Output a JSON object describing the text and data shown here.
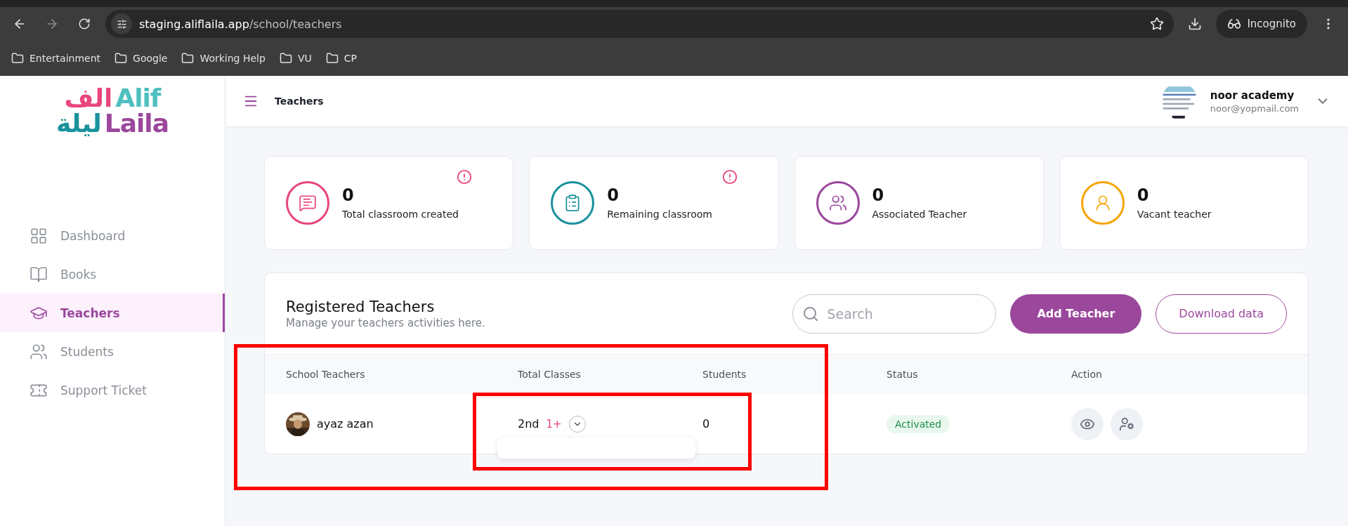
{
  "browser": {
    "url_host": "staging.aliflaila.app",
    "url_path": "/school/teachers",
    "profile": "Incognito",
    "bookmarks": [
      "Entertainment",
      "Google",
      "Working Help",
      "VU",
      "CP"
    ]
  },
  "logo": {
    "arabic_top": "الف",
    "latin_top": "Alif",
    "arabic_bottom": "ليلة",
    "latin_bottom": "Laila"
  },
  "sidebar": {
    "items": [
      {
        "label": "Dashboard",
        "selected": false
      },
      {
        "label": "Books",
        "selected": false
      },
      {
        "label": "Teachers",
        "selected": true
      },
      {
        "label": "Students",
        "selected": false
      },
      {
        "label": "Support Ticket",
        "selected": false
      }
    ]
  },
  "header": {
    "title": "Teachers",
    "user_name": "noor academy",
    "user_email": "noor@yopmail.com"
  },
  "stats": [
    {
      "value": "0",
      "label": "Total classroom created",
      "color": "#e8467c",
      "alert": true
    },
    {
      "value": "0",
      "label": "Remaining classroom",
      "color": "#1a929e",
      "alert": true
    },
    {
      "value": "0",
      "label": "Associated Teacher",
      "color": "#9b479c",
      "alert": false
    },
    {
      "value": "0",
      "label": "Vacant teacher",
      "color": "#f6a609",
      "alert": false
    }
  ],
  "table": {
    "title": "Registered Teachers",
    "subtitle": "Manage your teachers activities here.",
    "search_placeholder": "Search",
    "add_button": "Add Teacher",
    "download_button": "Download data",
    "columns": [
      "School Teachers",
      "Total Classes",
      "Students",
      "Status",
      "Action"
    ],
    "rows": [
      {
        "name": "ayaz azan",
        "class": "2nd",
        "more": "1+",
        "students": "0",
        "status": "Activated",
        "expanded": true
      }
    ]
  }
}
